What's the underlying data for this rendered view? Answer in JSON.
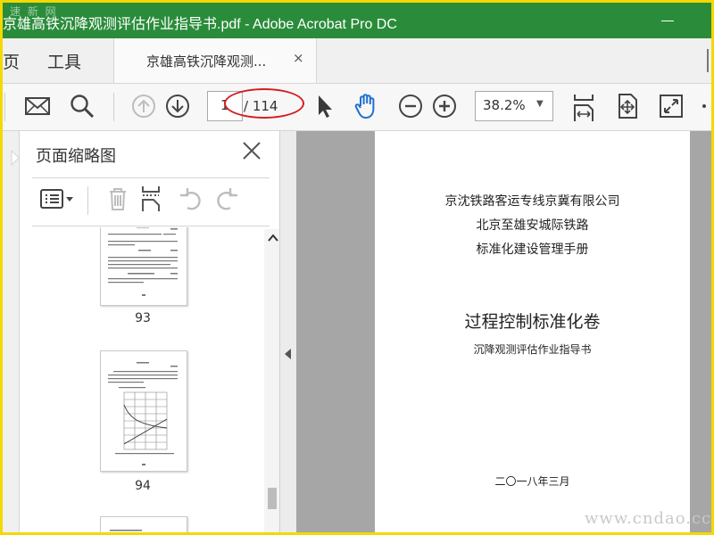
{
  "window": {
    "title": "京雄高铁沉降观测评估作业指导书.pdf - Adobe Acrobat Pro DC",
    "watermark_top": "速 新 网"
  },
  "tabs": {
    "home_label": "页",
    "tools_label": "工具",
    "doc_tab_label": "京雄高铁沉降观测...",
    "close_glyph": "×"
  },
  "toolbar": {
    "page_current": "1",
    "page_total": "/ 114",
    "zoom": "38.2%",
    "zoom_caret": "▼"
  },
  "panel": {
    "title": "页面缩略图",
    "thumbnails": [
      {
        "label": "93"
      },
      {
        "label": "94"
      }
    ]
  },
  "document": {
    "lines": [
      "京沈铁路客运专线京冀有限公司",
      "北京至雄安城际铁路",
      "标准化建设管理手册",
      "过程控制标准化卷",
      "沉降观测评估作业指导书",
      "二〇一八年三月"
    ]
  },
  "watermark_bottom": "www.cndao.cc",
  "colors": {
    "titlebar": "#2a8c3a",
    "highlight": "#d42020",
    "frame": "#f5d800"
  }
}
